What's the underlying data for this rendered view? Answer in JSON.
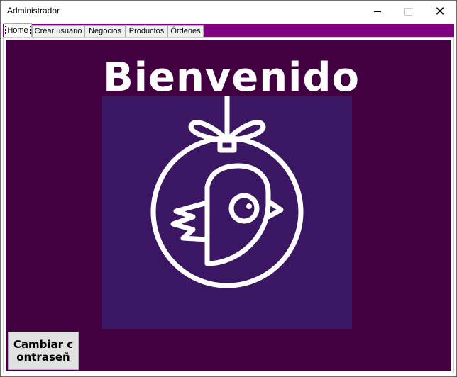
{
  "window": {
    "title": "Administrador",
    "controls": [
      "minimize-icon",
      "maximize-icon",
      "close-icon"
    ],
    "close_glyph": "✕"
  },
  "tabs": [
    {
      "label": "Home",
      "active": true
    },
    {
      "label": "Crear usuario",
      "active": false
    },
    {
      "label": "Negocios",
      "active": false
    },
    {
      "label": "Productos",
      "active": false
    },
    {
      "label": "Órdenes",
      "active": false
    }
  ],
  "home": {
    "heading": "Bienvenido",
    "logo_icon": "ornament-bird-logo",
    "change_password_label": "Cambiar contraseñ"
  },
  "colors": {
    "tabstrip": "#800080",
    "background": "#420041",
    "logo_background": "#3b1763",
    "heading": "#ffffff"
  }
}
